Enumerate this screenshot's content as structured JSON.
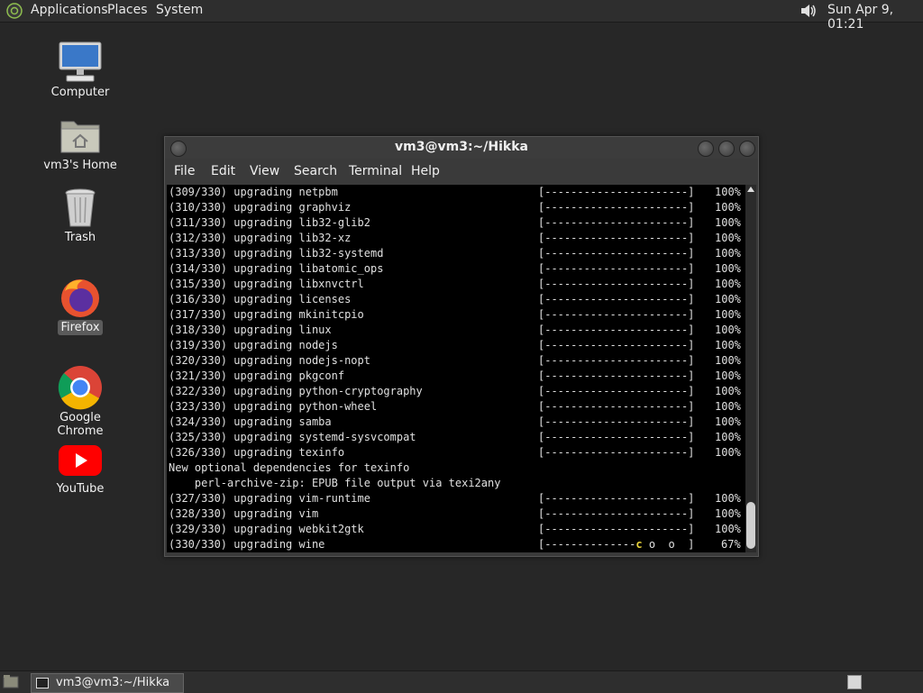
{
  "top_panel": {
    "menus": [
      "Applications",
      "Places",
      "System"
    ],
    "clock": "Sun Apr  9, 01:21"
  },
  "desktop_icons": [
    {
      "label": "Computer",
      "icon": "computer-icon"
    },
    {
      "label": "vm3's Home",
      "icon": "home-folder-icon"
    },
    {
      "label": "Trash",
      "icon": "trash-icon"
    },
    {
      "label": "Firefox",
      "icon": "firefox-icon",
      "selected": true
    },
    {
      "label": "Google Chrome",
      "icon": "chrome-icon"
    },
    {
      "label": "YouTube",
      "icon": "youtube-icon"
    }
  ],
  "terminal": {
    "title": "vm3@vm3:~/Hikka",
    "menu": [
      "File",
      "Edit",
      "View",
      "Search",
      "Terminal",
      "Help"
    ],
    "full_bar": "[----------------------]",
    "lines": [
      {
        "text": "(309/330) upgrading netpbm",
        "pct": "100%"
      },
      {
        "text": "(310/330) upgrading graphviz",
        "pct": "100%"
      },
      {
        "text": "(311/330) upgrading lib32-glib2",
        "pct": "100%"
      },
      {
        "text": "(312/330) upgrading lib32-xz",
        "pct": "100%"
      },
      {
        "text": "(313/330) upgrading lib32-systemd",
        "pct": "100%"
      },
      {
        "text": "(314/330) upgrading libatomic_ops",
        "pct": "100%"
      },
      {
        "text": "(315/330) upgrading libxnvctrl",
        "pct": "100%"
      },
      {
        "text": "(316/330) upgrading licenses",
        "pct": "100%"
      },
      {
        "text": "(317/330) upgrading mkinitcpio",
        "pct": "100%"
      },
      {
        "text": "(318/330) upgrading linux",
        "pct": "100%"
      },
      {
        "text": "(319/330) upgrading nodejs",
        "pct": "100%"
      },
      {
        "text": "(320/330) upgrading nodejs-nopt",
        "pct": "100%"
      },
      {
        "text": "(321/330) upgrading pkgconf",
        "pct": "100%"
      },
      {
        "text": "(322/330) upgrading python-cryptography",
        "pct": "100%"
      },
      {
        "text": "(323/330) upgrading python-wheel",
        "pct": "100%"
      },
      {
        "text": "(324/330) upgrading samba",
        "pct": "100%"
      },
      {
        "text": "(325/330) upgrading systemd-sysvcompat",
        "pct": "100%"
      },
      {
        "text": "(326/330) upgrading texinfo",
        "pct": "100%"
      },
      {
        "text": "New optional dependencies for texinfo"
      },
      {
        "text": "    perl-archive-zip: EPUB file output via texi2any"
      },
      {
        "text": "(327/330) upgrading vim-runtime",
        "pct": "100%"
      },
      {
        "text": "(328/330) upgrading vim",
        "pct": "100%"
      },
      {
        "text": "(329/330) upgrading webkit2gtk",
        "pct": "100%"
      },
      {
        "text": "(330/330) upgrading wine",
        "pct": "67%",
        "partial": true
      }
    ],
    "partial_bar": {
      "done": "[--------------",
      "pac": "c",
      "rest": " o  o  ]"
    }
  },
  "taskbar": {
    "task_label": "vm3@vm3:~/Hikka"
  },
  "colors": {
    "desktop": "#272727",
    "panel": "#2e2e2e",
    "terminal_bg": "#000000",
    "terminal_fg": "#e0e0e0",
    "pacman": "#e8d23a"
  }
}
